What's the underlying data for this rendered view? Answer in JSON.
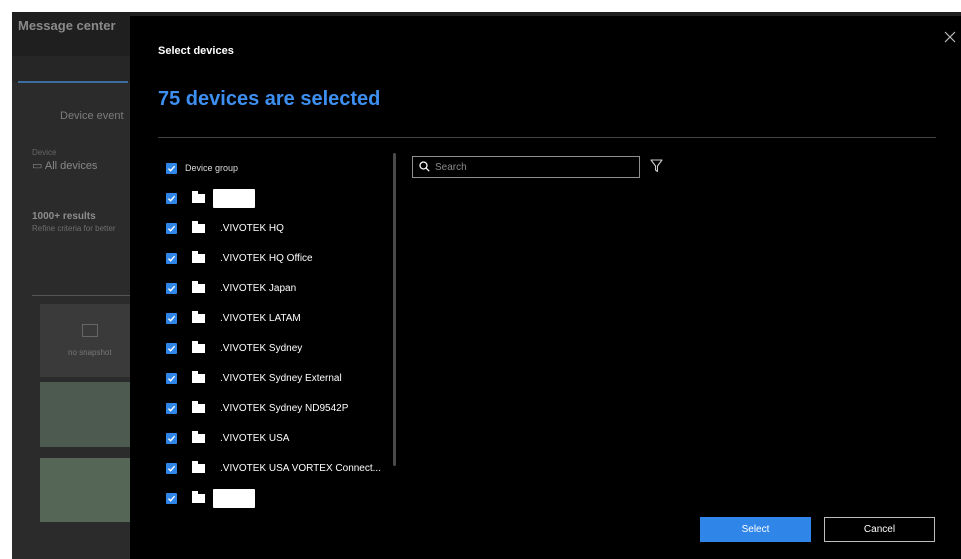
{
  "background": {
    "title": "Message center",
    "tab": "Device event",
    "device_label": "Device",
    "device_value": "All devices",
    "results_count": "1000+ results",
    "results_hint": "Refine criteria for better",
    "no_snapshot": "no snapshot"
  },
  "dialog": {
    "title": "Select devices",
    "selected_count": "75 devices are selected",
    "search_placeholder": "Search",
    "group_header": "Device group",
    "groups": [
      {
        "label": ""
      },
      {
        "label": ".VIVOTEK HQ"
      },
      {
        "label": ".VIVOTEK HQ Office"
      },
      {
        "label": ".VIVOTEK Japan"
      },
      {
        "label": ".VIVOTEK LATAM"
      },
      {
        "label": ".VIVOTEK Sydney"
      },
      {
        "label": ".VIVOTEK Sydney External"
      },
      {
        "label": ".VIVOTEK Sydney ND9542P"
      },
      {
        "label": ".VIVOTEK USA"
      },
      {
        "label": ".VIVOTEK USA VORTEX Connect..."
      },
      {
        "label": ""
      }
    ],
    "select_label": "Select",
    "cancel_label": "Cancel"
  },
  "colors": {
    "accent": "#2f86e8",
    "heading_blue": "#3d8ff0",
    "modal_bg": "#000000"
  },
  "icons": [
    "close-icon",
    "checkbox-checked-icon",
    "folder-icon",
    "search-icon",
    "filter-icon",
    "image-placeholder-icon",
    "camera-icon"
  ]
}
